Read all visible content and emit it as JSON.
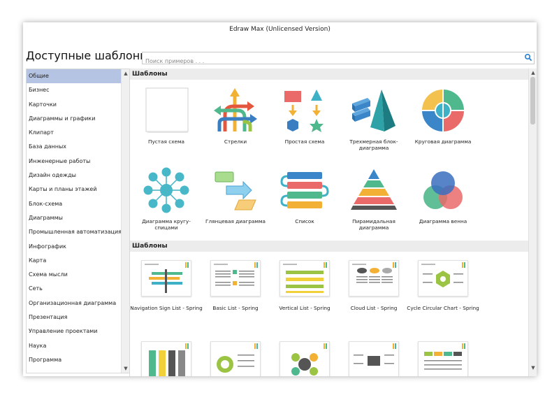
{
  "window": {
    "title": "Edraw Max (Unlicensed Version)"
  },
  "header": {
    "heading": "Доступные шаблоны",
    "search_placeholder": "Поиск примеров . . ."
  },
  "sidebar": {
    "items": [
      {
        "label": "Общие",
        "active": true
      },
      {
        "label": "Бизнес"
      },
      {
        "label": "Карточки"
      },
      {
        "label": "Диаграммы и графики"
      },
      {
        "label": "Клипарт"
      },
      {
        "label": "База данных"
      },
      {
        "label": "Инженерные работы"
      },
      {
        "label": "Дизайн одежды"
      },
      {
        "label": "Карты и планы этажей"
      },
      {
        "label": "Блок-схема"
      },
      {
        "label": "Диаграммы"
      },
      {
        "label": "Промышленная автоматизация"
      },
      {
        "label": "Инфографик"
      },
      {
        "label": "Карта"
      },
      {
        "label": "Схема мысли"
      },
      {
        "label": "Сеть"
      },
      {
        "label": "Организационная диаграмма"
      },
      {
        "label": "Презентация"
      },
      {
        "label": "Управление проектами"
      },
      {
        "label": "Наука"
      },
      {
        "label": "Программа"
      }
    ]
  },
  "sections": {
    "first_title": "Шаблоны",
    "second_title": "Шаблоны"
  },
  "shapes": [
    {
      "label": "Пустая схема",
      "icon": "blank-page-icon"
    },
    {
      "label": "Стрелки",
      "icon": "arrows-icon"
    },
    {
      "label": "Простая схема",
      "icon": "basic-shapes-icon"
    },
    {
      "label": "Трехмерная блок-диаграмма",
      "icon": "3d-block-icon"
    },
    {
      "label": "Круговая диаграмма",
      "icon": "circular-diagram-icon"
    },
    {
      "label": "Диаграмма кругу-спицами",
      "icon": "hub-spoke-icon"
    },
    {
      "label": "Глянцевая диаграмма",
      "icon": "glossy-diagram-icon"
    },
    {
      "label": "Список",
      "icon": "list-icon"
    },
    {
      "label": "Пирамидальная диаграмма",
      "icon": "pyramid-icon"
    },
    {
      "label": "Диаграмма венна",
      "icon": "venn-icon"
    }
  ],
  "templates": [
    {
      "label": "Navigation Sign List - Spring"
    },
    {
      "label": "Basic List - Spring"
    },
    {
      "label": "Vertical List - Spring"
    },
    {
      "label": "Cloud List - Spring"
    },
    {
      "label": "Cycle Circular Chart - Spring"
    }
  ],
  "colors": {
    "accent": "#b4c4e2",
    "search_icon": "#2a7fd4"
  }
}
